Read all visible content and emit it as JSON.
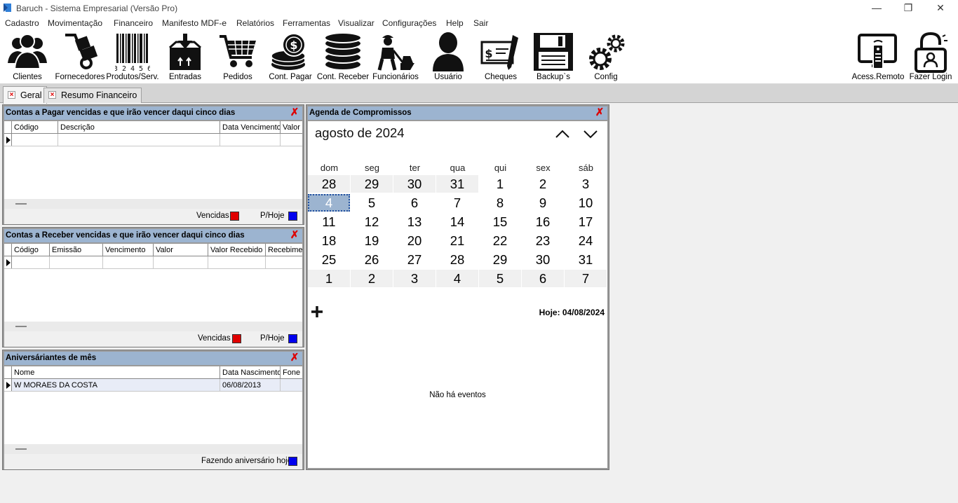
{
  "window": {
    "title": "Baruch - Sistema Empresarial (Versão Pro)",
    "minimize": "—",
    "restore": "❐",
    "close": "✕"
  },
  "menu": [
    "Cadastro",
    "Movimentação",
    "Financeiro",
    "Manifesto MDF-e",
    "Relatórios",
    "Ferramentas",
    "Visualizar",
    "Configurações",
    "Help",
    "Sair"
  ],
  "toolbar": {
    "clientes": "Clientes",
    "fornecedores": "Fornecedores",
    "produtos": "Produtos/Serv.",
    "barcode_number": "3 2 4 5 6",
    "entradas": "Entradas",
    "pedidos": "Pedidos",
    "cont_pagar": "Cont. Pagar",
    "cont_receber": "Cont. Receber",
    "funcionarios": "Funcionários",
    "usuario": "Usuário",
    "cheques": "Cheques",
    "backup": "Backup`s",
    "config": "Config",
    "acess_remoto": "Acess.Remoto",
    "fazer_login": "Fazer Login"
  },
  "tabs": {
    "geral": "Geral",
    "resumo": "Resumo Financeiro"
  },
  "pagar": {
    "title": "Contas a Pagar vencidas e que irão vencer daqui cinco dias",
    "cols": [
      "Código",
      "Descrição",
      "Data Vencimento",
      "Valor"
    ],
    "legend_vencidas": "Vencidas",
    "legend_hoje": "P/Hoje"
  },
  "receber": {
    "title": "Contas a Receber vencidas e que irão vencer daqui cinco dias",
    "cols": [
      "Código",
      "Emissão",
      "Vencimento",
      "Valor",
      "Valor Recebido",
      "Recebimento"
    ],
    "legend_vencidas": "Vencidas",
    "legend_hoje": "P/Hoje"
  },
  "aniversariantes": {
    "title": "Aniversáriantes de mês",
    "cols": [
      "Nome",
      "Data Nascimento",
      "Fone C"
    ],
    "rows": [
      {
        "nome": "W MORAES DA COSTA",
        "data": "06/08/2013",
        "fone": ""
      }
    ],
    "legend": "Fazendo aniversário hoje"
  },
  "agenda": {
    "title": "Agenda de Compromissos",
    "month": "agosto de 2024",
    "weekdays": [
      "dom",
      "seg",
      "ter",
      "qua",
      "qui",
      "sex",
      "sáb"
    ],
    "weeks": [
      [
        "28",
        "29",
        "30",
        "31",
        "1",
        "2",
        "3"
      ],
      [
        "4",
        "5",
        "6",
        "7",
        "8",
        "9",
        "10"
      ],
      [
        "11",
        "12",
        "13",
        "14",
        "15",
        "16",
        "17"
      ],
      [
        "18",
        "19",
        "20",
        "21",
        "22",
        "23",
        "24"
      ],
      [
        "25",
        "26",
        "27",
        "28",
        "29",
        "30",
        "31"
      ],
      [
        "1",
        "2",
        "3",
        "4",
        "5",
        "6",
        "7"
      ]
    ],
    "selected_day": "4",
    "today_label": "Hoje: 04/08/2024",
    "no_events": "Não há eventos"
  },
  "colors": {
    "vencidas": "#e00000",
    "hoje": "#0000ee",
    "panel_header": "#9cb4d0"
  }
}
